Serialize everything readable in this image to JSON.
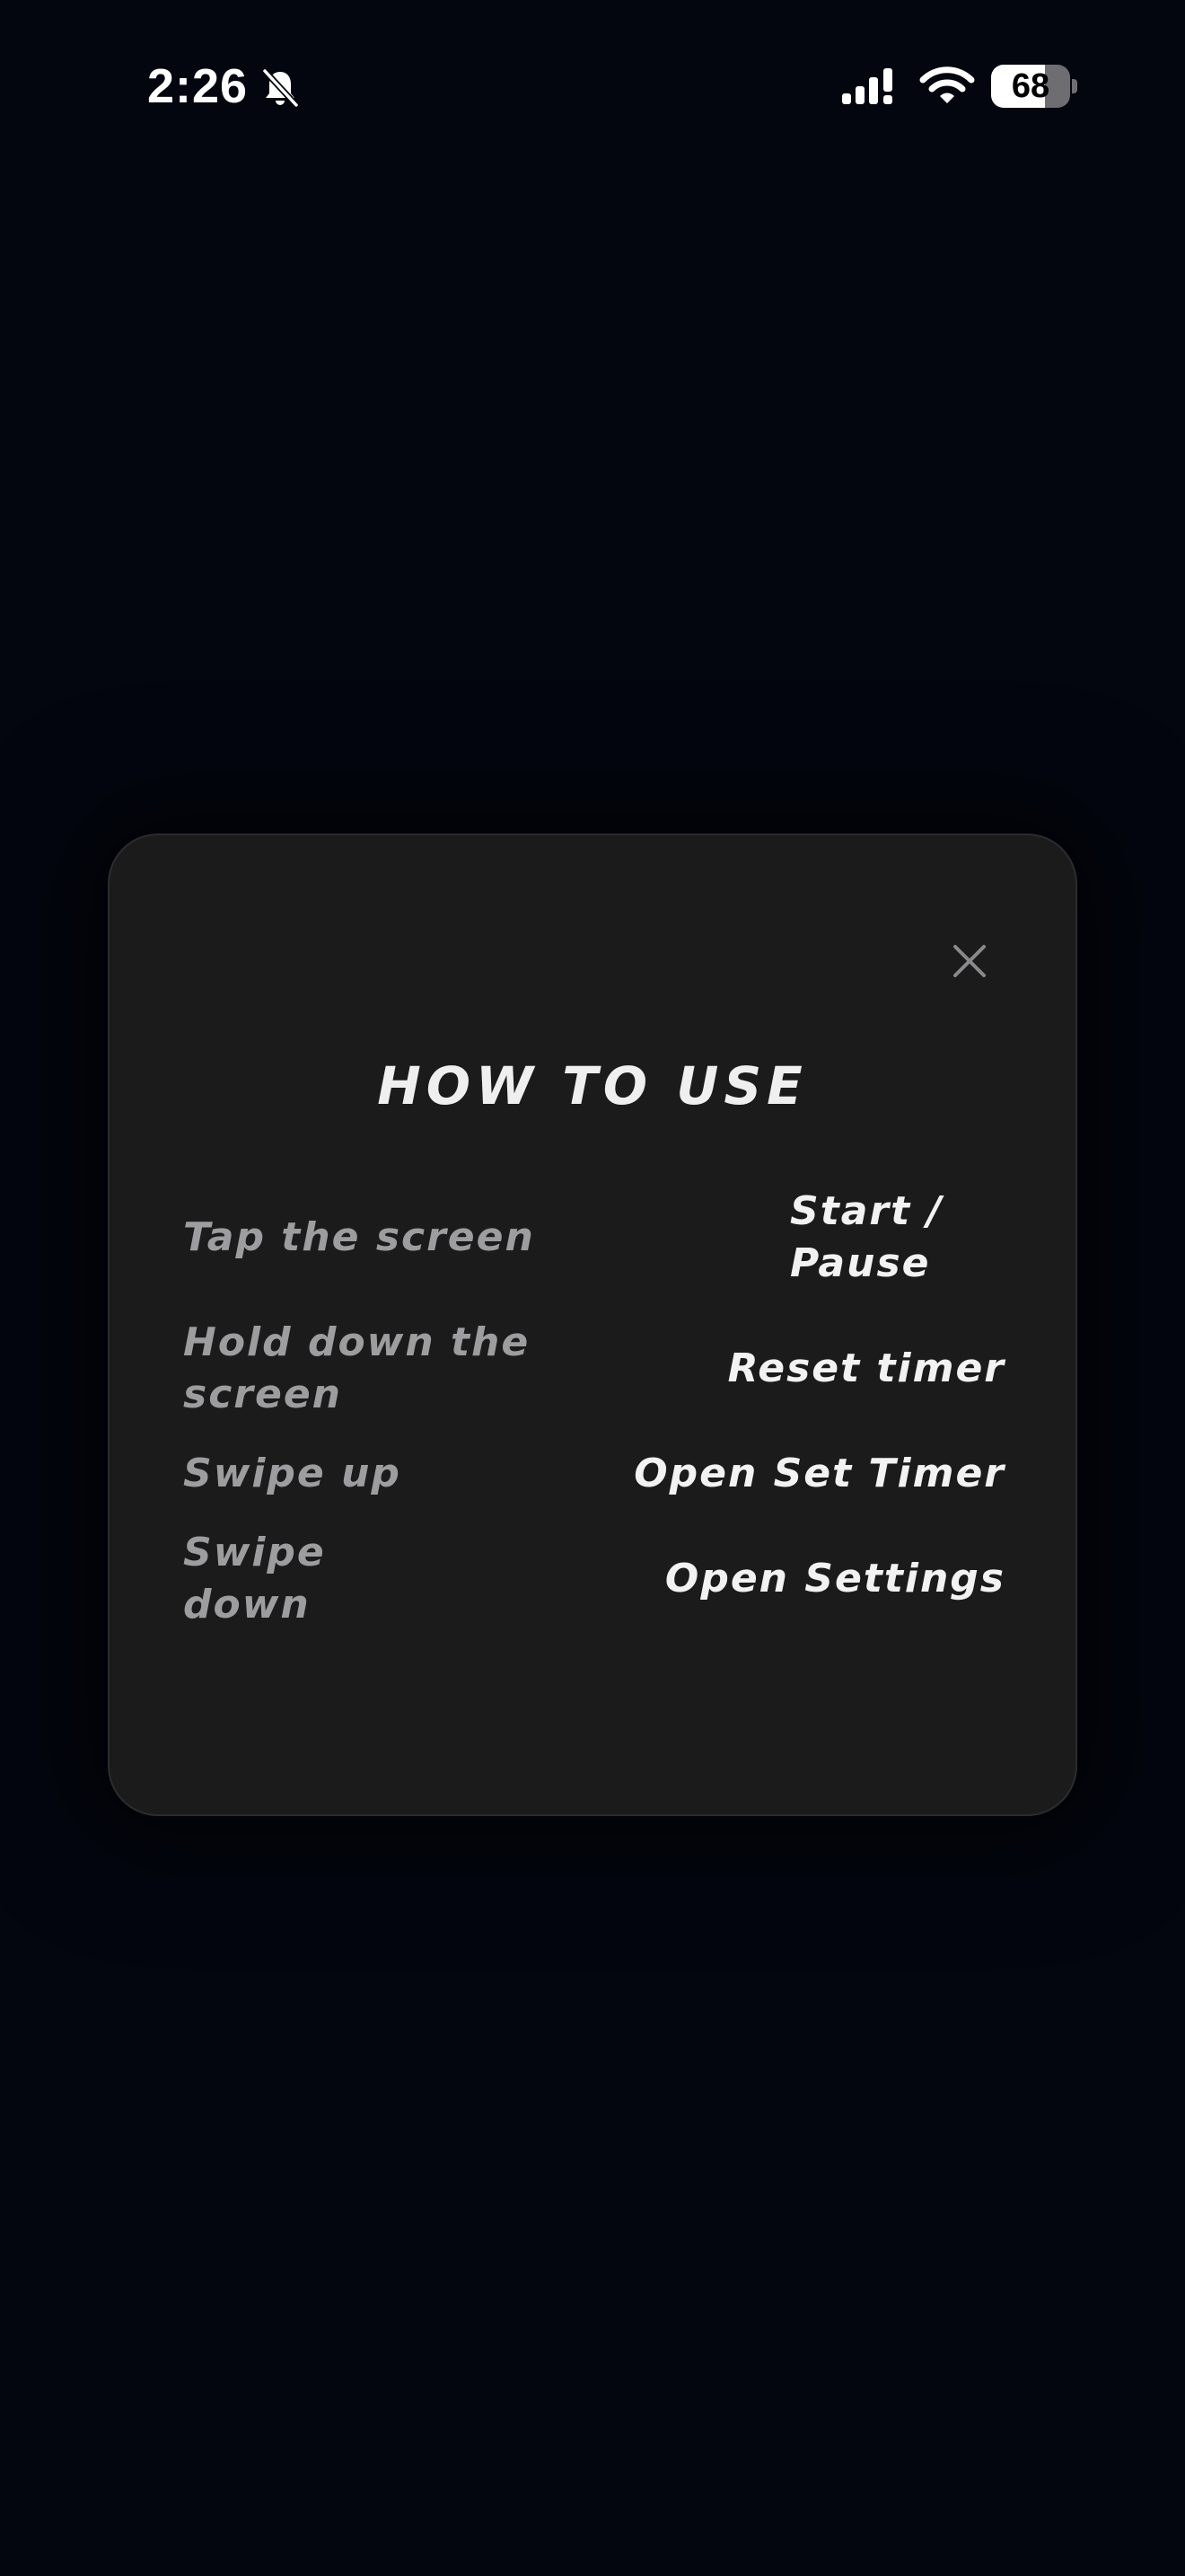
{
  "status_bar": {
    "time": "2:26",
    "icons": {
      "silent": "bell-slash-icon",
      "signal": "cellular-signal-icon",
      "wifi": "wifi-icon",
      "battery": "battery-icon"
    },
    "battery_level": "68",
    "battery_fraction": 0.68
  },
  "dialog": {
    "title": "HOW TO USE",
    "close_icon": "close-icon",
    "gestures": [
      {
        "gesture": "Tap the screen",
        "action": "Start / Pause"
      },
      {
        "gesture": "Hold down the screen",
        "action": "Reset timer"
      },
      {
        "gesture": "Swipe up",
        "action": "Open Set Timer"
      },
      {
        "gesture": "Swipe down",
        "action": "Open Settings"
      }
    ]
  },
  "colors": {
    "background": "#03060f",
    "dialog_background": "#1b1b1c",
    "gesture_text": "#9d9d9f",
    "action_text": "#f2f2f2"
  }
}
